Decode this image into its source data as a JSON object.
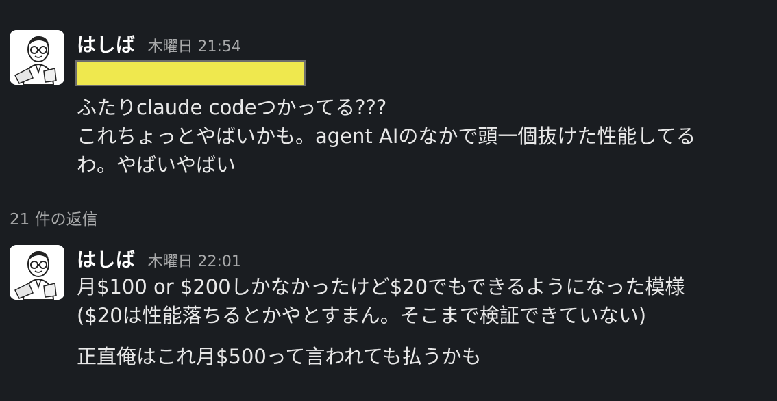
{
  "messages": [
    {
      "author": "はしば",
      "timestamp": "木曜日 21:54",
      "avatar_icon": "avatar-illustration-icon",
      "lines": [
        "ふたりclaude codeつかってる???",
        "これちょっとやばいかも。agent AIのなかで頭一個抜けた性能してる",
        "わ。やばいやばい"
      ]
    },
    {
      "author": "はしば",
      "timestamp": "木曜日 22:01",
      "avatar_icon": "avatar-illustration-icon",
      "lines": [
        "月$100 or $200しかなかったけど$20でもできるようになった模様",
        "($20は性能落ちるとかやとすまん。そこまで検証できていない)",
        "正直俺はこれ月$500って言われても払うかも"
      ]
    }
  ],
  "thread": {
    "replies_label": "21 件の返信"
  },
  "colors": {
    "background": "#1a1d21",
    "redaction": "#efe84e",
    "text": "#e8e8e8",
    "muted": "#a8a9aa"
  }
}
